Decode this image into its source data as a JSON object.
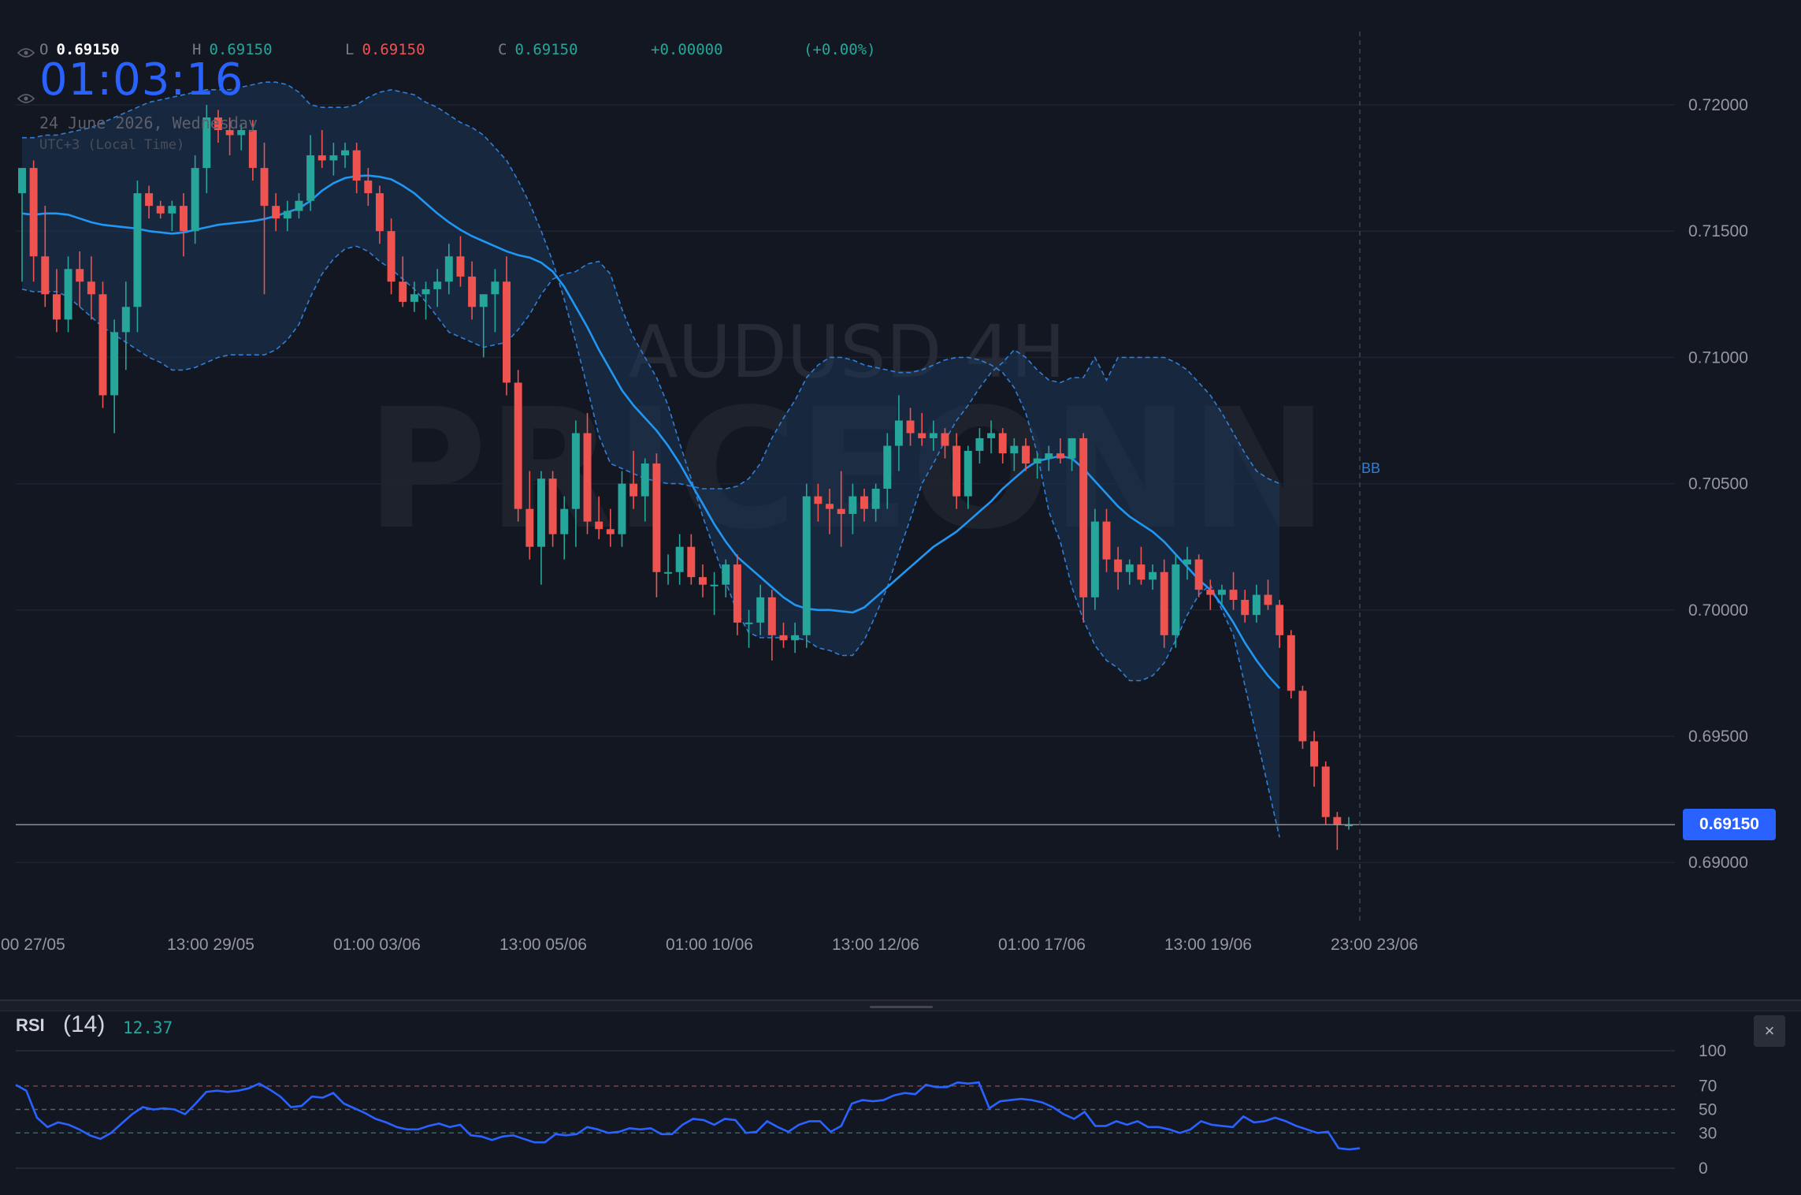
{
  "header": {
    "o_label": "O",
    "o_value": "0.69150",
    "h_label": "H",
    "h_value": "0.69150",
    "l_label": "L",
    "l_value": "0.69150",
    "c_label": "C",
    "c_value": "0.69150",
    "change": "+0.00000",
    "change_pct": "(+0.00%)",
    "clock": "01:03:16",
    "date": "24 June 2026, Wednesday",
    "timezone": "UTC+3 (Local Time)"
  },
  "watermark": {
    "line1": "AUDUSD 4H",
    "line2": "PRICEONN"
  },
  "price_label": "0.69150",
  "indicator_label": "BB",
  "rsi": {
    "title": "RSI",
    "length": "(14)",
    "value": "12.37",
    "close_label": "×"
  },
  "colors": {
    "background": "#131722",
    "up": "#26a69a",
    "down": "#ef5350",
    "basis": "#2196f3",
    "band": "#1e3a5f",
    "accent": "#2962ff",
    "rsi_line": "#2962ff"
  },
  "icons": {
    "visibility": "eye-icon",
    "close": "close-icon"
  },
  "chart_data": [
    {
      "type": "candlestick",
      "symbol": "AUDUSD",
      "timeframe": "4H",
      "title": "AUDUSD 4H",
      "ylim": [
        0.6875,
        0.7215
      ],
      "y_ticks": [
        "0.69000",
        "0.69500",
        "0.70000",
        "0.70500",
        "0.71000",
        "0.71500",
        "0.72000"
      ],
      "x_tick_labels": [
        "00 27/05",
        "13:00 29/05",
        "01:00 03/06",
        "13:00 05/06",
        "01:00 10/06",
        "13:00 12/06",
        "01:00 17/06",
        "13:00 19/06",
        "23:00 23/06"
      ],
      "last_price": 0.6915,
      "grid": true,
      "ohlc": [
        [
          0.7165,
          0.7175,
          0.713,
          0.7175
        ],
        [
          0.7175,
          0.7178,
          0.713,
          0.714
        ],
        [
          0.714,
          0.716,
          0.712,
          0.7125
        ],
        [
          0.7125,
          0.7135,
          0.711,
          0.7115
        ],
        [
          0.7115,
          0.714,
          0.711,
          0.7135
        ],
        [
          0.7135,
          0.7142,
          0.712,
          0.713
        ],
        [
          0.713,
          0.714,
          0.7115,
          0.7125
        ],
        [
          0.7125,
          0.713,
          0.708,
          0.7085
        ],
        [
          0.7085,
          0.7115,
          0.707,
          0.711
        ],
        [
          0.711,
          0.713,
          0.7095,
          0.712
        ],
        [
          0.712,
          0.717,
          0.711,
          0.7165
        ],
        [
          0.7165,
          0.7168,
          0.7155,
          0.716
        ],
        [
          0.716,
          0.7162,
          0.7155,
          0.7157
        ],
        [
          0.7157,
          0.7162,
          0.715,
          0.716
        ],
        [
          0.716,
          0.7165,
          0.714,
          0.715
        ],
        [
          0.715,
          0.718,
          0.7145,
          0.7175
        ],
        [
          0.7175,
          0.72,
          0.7165,
          0.7195
        ],
        [
          0.7195,
          0.7198,
          0.7185,
          0.719
        ],
        [
          0.719,
          0.7195,
          0.718,
          0.7188
        ],
        [
          0.7188,
          0.7192,
          0.7182,
          0.719
        ],
        [
          0.719,
          0.7194,
          0.717,
          0.7175
        ],
        [
          0.7175,
          0.7185,
          0.7125,
          0.716
        ],
        [
          0.716,
          0.7165,
          0.715,
          0.7155
        ],
        [
          0.7155,
          0.7162,
          0.715,
          0.7158
        ],
        [
          0.7158,
          0.7165,
          0.7155,
          0.7162
        ],
        [
          0.7162,
          0.7188,
          0.7158,
          0.718
        ],
        [
          0.718,
          0.719,
          0.7175,
          0.7178
        ],
        [
          0.7178,
          0.7185,
          0.7172,
          0.718
        ],
        [
          0.718,
          0.7185,
          0.7175,
          0.7182
        ],
        [
          0.7182,
          0.7185,
          0.7165,
          0.717
        ],
        [
          0.717,
          0.7175,
          0.716,
          0.7165
        ],
        [
          0.7165,
          0.7168,
          0.7145,
          0.715
        ],
        [
          0.715,
          0.7155,
          0.7125,
          0.713
        ],
        [
          0.713,
          0.714,
          0.712,
          0.7122
        ],
        [
          0.7122,
          0.713,
          0.7118,
          0.7125
        ],
        [
          0.7125,
          0.713,
          0.7115,
          0.7127
        ],
        [
          0.7127,
          0.7135,
          0.712,
          0.713
        ],
        [
          0.713,
          0.7145,
          0.7125,
          0.714
        ],
        [
          0.714,
          0.7148,
          0.7128,
          0.7132
        ],
        [
          0.7132,
          0.7138,
          0.7115,
          0.712
        ],
        [
          0.712,
          0.7125,
          0.71,
          0.7125
        ],
        [
          0.7125,
          0.7135,
          0.711,
          0.713
        ],
        [
          0.713,
          0.714,
          0.7085,
          0.709
        ],
        [
          0.709,
          0.7095,
          0.7035,
          0.704
        ],
        [
          0.704,
          0.7055,
          0.702,
          0.7025
        ],
        [
          0.7025,
          0.7055,
          0.701,
          0.7052
        ],
        [
          0.7052,
          0.7055,
          0.7025,
          0.703
        ],
        [
          0.703,
          0.7045,
          0.702,
          0.704
        ],
        [
          0.704,
          0.7075,
          0.7025,
          0.707
        ],
        [
          0.707,
          0.7078,
          0.703,
          0.7035
        ],
        [
          0.7035,
          0.7045,
          0.7028,
          0.7032
        ],
        [
          0.7032,
          0.704,
          0.7025,
          0.703
        ],
        [
          0.703,
          0.7055,
          0.7025,
          0.705
        ],
        [
          0.705,
          0.7063,
          0.704,
          0.7045
        ],
        [
          0.7045,
          0.706,
          0.7035,
          0.7058
        ],
        [
          0.7058,
          0.7062,
          0.7005,
          0.7015
        ],
        [
          0.7015,
          0.7022,
          0.701,
          0.7015
        ],
        [
          0.7015,
          0.703,
          0.701,
          0.7025
        ],
        [
          0.7025,
          0.703,
          0.701,
          0.7013
        ],
        [
          0.7013,
          0.7018,
          0.7005,
          0.701
        ],
        [
          0.701,
          0.7015,
          0.6998,
          0.701
        ],
        [
          0.701,
          0.702,
          0.7005,
          0.7018
        ],
        [
          0.7018,
          0.7022,
          0.699,
          0.6995
        ],
        [
          0.6995,
          0.7,
          0.6985,
          0.6995
        ],
        [
          0.6995,
          0.701,
          0.699,
          0.7005
        ],
        [
          0.7005,
          0.7008,
          0.698,
          0.699
        ],
        [
          0.699,
          0.6995,
          0.6985,
          0.6988
        ],
        [
          0.6988,
          0.6995,
          0.6983,
          0.699
        ],
        [
          0.699,
          0.705,
          0.6985,
          0.7045
        ],
        [
          0.7045,
          0.705,
          0.7035,
          0.7042
        ],
        [
          0.7042,
          0.7048,
          0.703,
          0.704
        ],
        [
          0.704,
          0.7055,
          0.7025,
          0.7038
        ],
        [
          0.7038,
          0.705,
          0.703,
          0.7045
        ],
        [
          0.7045,
          0.7048,
          0.7035,
          0.704
        ],
        [
          0.704,
          0.705,
          0.7035,
          0.7048
        ],
        [
          0.7048,
          0.707,
          0.704,
          0.7065
        ],
        [
          0.7065,
          0.7085,
          0.7055,
          0.7075
        ],
        [
          0.7075,
          0.708,
          0.7065,
          0.707
        ],
        [
          0.707,
          0.7078,
          0.7065,
          0.7068
        ],
        [
          0.7068,
          0.7075,
          0.7063,
          0.707
        ],
        [
          0.707,
          0.7072,
          0.706,
          0.7065
        ],
        [
          0.7065,
          0.707,
          0.704,
          0.7045
        ],
        [
          0.7045,
          0.7065,
          0.704,
          0.7063
        ],
        [
          0.7063,
          0.7072,
          0.7058,
          0.7068
        ],
        [
          0.7068,
          0.7075,
          0.7062,
          0.707
        ],
        [
          0.707,
          0.7072,
          0.7058,
          0.7062
        ],
        [
          0.7062,
          0.7068,
          0.7055,
          0.7065
        ],
        [
          0.7065,
          0.7068,
          0.7055,
          0.7058
        ],
        [
          0.7058,
          0.7062,
          0.7052,
          0.706
        ],
        [
          0.706,
          0.7065,
          0.7055,
          0.7062
        ],
        [
          0.7062,
          0.7068,
          0.7058,
          0.706
        ],
        [
          0.706,
          0.7068,
          0.7055,
          0.7068
        ],
        [
          0.7068,
          0.707,
          0.6995,
          0.7005
        ],
        [
          0.7005,
          0.704,
          0.7,
          0.7035
        ],
        [
          0.7035,
          0.704,
          0.7015,
          0.702
        ],
        [
          0.702,
          0.7025,
          0.7008,
          0.7015
        ],
        [
          0.7015,
          0.702,
          0.701,
          0.7018
        ],
        [
          0.7018,
          0.7025,
          0.701,
          0.7012
        ],
        [
          0.7012,
          0.7018,
          0.7008,
          0.7015
        ],
        [
          0.7015,
          0.702,
          0.6985,
          0.699
        ],
        [
          0.699,
          0.7022,
          0.6985,
          0.7018
        ],
        [
          0.7018,
          0.7025,
          0.7012,
          0.702
        ],
        [
          0.702,
          0.7022,
          0.7005,
          0.7008
        ],
        [
          0.7008,
          0.7012,
          0.7,
          0.7006
        ],
        [
          0.7006,
          0.701,
          0.7002,
          0.7008
        ],
        [
          0.7008,
          0.7015,
          0.7,
          0.7004
        ],
        [
          0.7004,
          0.7008,
          0.6995,
          0.6998
        ],
        [
          0.6998,
          0.701,
          0.6995,
          0.7006
        ],
        [
          0.7006,
          0.7012,
          0.7,
          0.7002
        ],
        [
          0.7002,
          0.7004,
          0.6985,
          0.699
        ],
        [
          0.699,
          0.6992,
          0.6965,
          0.6968
        ],
        [
          0.6968,
          0.697,
          0.6945,
          0.6948
        ],
        [
          0.6948,
          0.6952,
          0.693,
          0.6938
        ],
        [
          0.6938,
          0.694,
          0.6915,
          0.6918
        ],
        [
          0.6918,
          0.692,
          0.6905,
          0.6915
        ],
        [
          0.6915,
          0.6918,
          0.6913,
          0.6915
        ]
      ],
      "bollinger": {
        "label": "BB",
        "basis": [
          0.7157,
          0.71565,
          0.7157,
          0.7157,
          0.71565,
          0.7155,
          0.71535,
          0.71525,
          0.7152,
          0.71515,
          0.7151,
          0.715,
          0.71495,
          0.7149,
          0.71495,
          0.71505,
          0.71515,
          0.71525,
          0.7153,
          0.71535,
          0.7154,
          0.71548,
          0.7156,
          0.71575,
          0.7159,
          0.7162,
          0.7166,
          0.7169,
          0.7171,
          0.71718,
          0.7172,
          0.71715,
          0.71705,
          0.7168,
          0.7165,
          0.7161,
          0.7157,
          0.71535,
          0.71505,
          0.7148,
          0.7146,
          0.7144,
          0.7142,
          0.71405,
          0.71395,
          0.71375,
          0.7134,
          0.7128,
          0.712,
          0.7112,
          0.7103,
          0.7095,
          0.7087,
          0.7081,
          0.7076,
          0.7071,
          0.7065,
          0.7058,
          0.705,
          0.7042,
          0.7034,
          0.7027,
          0.7021,
          0.7017,
          0.7013,
          0.7009,
          0.7005,
          0.7002,
          0.70005,
          0.7,
          0.7,
          0.69995,
          0.6999,
          0.7001,
          0.7005,
          0.7009,
          0.7013,
          0.7017,
          0.7021,
          0.7025,
          0.7028,
          0.7031,
          0.7035,
          0.7039,
          0.7043,
          0.7048,
          0.7052,
          0.7056,
          0.7059,
          0.706,
          0.7061,
          0.706,
          0.7056,
          0.7051,
          0.7046,
          0.7041,
          0.7037,
          0.7034,
          0.7031,
          0.7027,
          0.7022,
          0.7017,
          0.7012,
          0.7008,
          0.7002,
          0.6995,
          0.6987,
          0.698,
          0.6974,
          0.6969
        ],
        "upper": [
          0.7187,
          0.7187,
          0.7188,
          0.7188,
          0.7189,
          0.719,
          0.7191,
          0.7193,
          0.7195,
          0.7197,
          0.7199,
          0.7201,
          0.7202,
          0.7203,
          0.7204,
          0.7205,
          0.7206,
          0.7206,
          0.7206,
          0.7207,
          0.7208,
          0.7209,
          0.7209,
          0.7208,
          0.7205,
          0.72,
          0.7199,
          0.7199,
          0.7199,
          0.72,
          0.7203,
          0.7205,
          0.7206,
          0.7205,
          0.7204,
          0.7201,
          0.7199,
          0.7196,
          0.7193,
          0.7191,
          0.7188,
          0.7183,
          0.7178,
          0.717,
          0.7161,
          0.715,
          0.7138,
          0.7123,
          0.7106,
          0.7088,
          0.7069,
          0.7058,
          0.7056,
          0.7054,
          0.7052,
          0.7051,
          0.705,
          0.705,
          0.7049,
          0.7048,
          0.7048,
          0.7048,
          0.7049,
          0.7052,
          0.7058,
          0.7068,
          0.7076,
          0.7083,
          0.7092,
          0.7097,
          0.71,
          0.71,
          0.7099,
          0.7097,
          0.7096,
          0.7095,
          0.7094,
          0.7094,
          0.7095,
          0.7097,
          0.7099,
          0.71,
          0.71,
          0.7099,
          0.7097,
          0.7094,
          0.7088,
          0.7078,
          0.7062,
          0.7039,
          0.7027,
          0.7009,
          0.6996,
          0.6986,
          0.698,
          0.6977,
          0.6972,
          0.6972,
          0.6974,
          0.6979,
          0.6988,
          0.6998,
          0.7006,
          0.701,
          0.7,
          0.699,
          0.697,
          0.695,
          0.693,
          0.691
        ],
        "lower": [
          0.7127,
          0.7126,
          0.7126,
          0.7126,
          0.7124,
          0.712,
          0.7116,
          0.7112,
          0.7109,
          0.7106,
          0.7103,
          0.71,
          0.7098,
          0.7095,
          0.7095,
          0.7096,
          0.7098,
          0.71,
          0.7101,
          0.7101,
          0.7101,
          0.7101,
          0.7103,
          0.7107,
          0.7113,
          0.7124,
          0.7133,
          0.7139,
          0.7143,
          0.7144,
          0.7142,
          0.7138,
          0.7135,
          0.7131,
          0.7127,
          0.7122,
          0.7116,
          0.711,
          0.7108,
          0.7106,
          0.7104,
          0.7105,
          0.7106,
          0.7111,
          0.7117,
          0.7125,
          0.7131,
          0.7133,
          0.7134,
          0.7137,
          0.7138,
          0.7133,
          0.7119,
          0.7108,
          0.71,
          0.7092,
          0.7081,
          0.7066,
          0.7052,
          0.7037,
          0.7024,
          0.7011,
          0.6999,
          0.6991,
          0.6989,
          0.6989,
          0.6989,
          0.6989,
          0.6988,
          0.6985,
          0.6984,
          0.6982,
          0.6982,
          0.6988,
          0.6998,
          0.7009,
          0.7023,
          0.7036,
          0.705,
          0.7058,
          0.7067,
          0.7075,
          0.7081,
          0.7088,
          0.7094,
          0.7098,
          0.7103,
          0.71,
          0.7095,
          0.7091,
          0.709,
          0.7092,
          0.7092,
          0.71,
          0.7091,
          0.71,
          0.71,
          0.71,
          0.71,
          0.71,
          0.7098,
          0.7095,
          0.709,
          0.7085,
          0.7078,
          0.707,
          0.7062,
          0.7055,
          0.7052,
          0.705
        ]
      }
    },
    {
      "type": "line",
      "title": "RSI",
      "length": 14,
      "last_value": 12.37,
      "ylim": [
        0,
        100
      ],
      "y_ticks": [
        0,
        30,
        50,
        70,
        100
      ],
      "levels": [
        30,
        50,
        70
      ],
      "values": [
        71,
        66,
        43,
        35,
        39,
        37,
        33,
        28,
        25,
        30,
        38,
        46,
        52,
        50,
        51,
        50,
        46,
        55,
        65,
        66,
        65,
        66,
        68,
        72,
        67,
        61,
        52,
        53,
        61,
        60,
        64,
        55,
        51,
        47,
        42,
        39,
        35,
        33,
        33,
        36,
        38,
        35,
        37,
        28,
        27,
        24,
        27,
        28,
        25,
        22,
        22,
        29,
        28,
        29,
        35,
        33,
        30,
        31,
        34,
        33,
        34,
        29,
        29,
        37,
        42,
        41,
        37,
        42,
        41,
        30,
        31,
        40,
        35,
        31,
        37,
        40,
        40,
        31,
        36,
        55,
        58,
        57,
        58,
        62,
        64,
        63,
        71,
        69,
        69,
        73,
        72,
        73,
        51,
        57,
        58,
        59,
        58,
        56,
        52,
        46,
        42,
        48,
        36,
        36,
        40,
        37,
        40,
        35,
        35,
        33,
        30,
        33,
        40,
        37,
        36,
        35,
        44,
        39,
        40,
        43,
        40,
        36,
        33,
        30,
        31,
        17,
        16,
        17
      ]
    }
  ]
}
